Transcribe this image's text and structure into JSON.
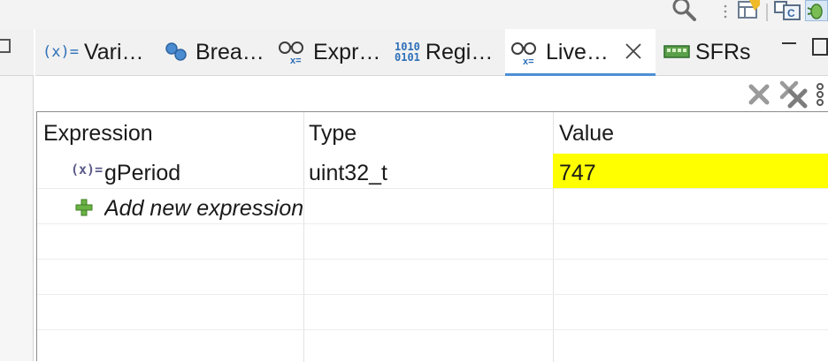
{
  "toolbar": {
    "icons": [
      "search-icon",
      "layout-icon",
      "cpp-icon",
      "debug-perspective-icon"
    ]
  },
  "tabs": [
    {
      "label": "Vari…",
      "icon": "variables-icon"
    },
    {
      "label": "Brea…",
      "icon": "breakpoints-icon"
    },
    {
      "label": "Expr…",
      "icon": "expressions-icon"
    },
    {
      "label": "Regi…",
      "icon": "registers-icon"
    },
    {
      "label": "Live…",
      "icon": "live-expressions-icon",
      "active": true
    },
    {
      "label": "SFRs",
      "icon": "sfrs-icon"
    }
  ],
  "view_toolbar": {
    "icons": [
      "remove-icon",
      "remove-all-icon",
      "view-menu-icon"
    ]
  },
  "table": {
    "columns": [
      "Expression",
      "Type",
      "Value"
    ],
    "rows": [
      {
        "expression": "gPeriod",
        "type": "uint32_t",
        "value": "747",
        "highlight": "#ffff00"
      }
    ],
    "add_new": "Add new expression"
  },
  "colors": {
    "accent": "#4b8fd6",
    "value_highlight": "#ffff00",
    "add_icon": "#6bb245"
  }
}
